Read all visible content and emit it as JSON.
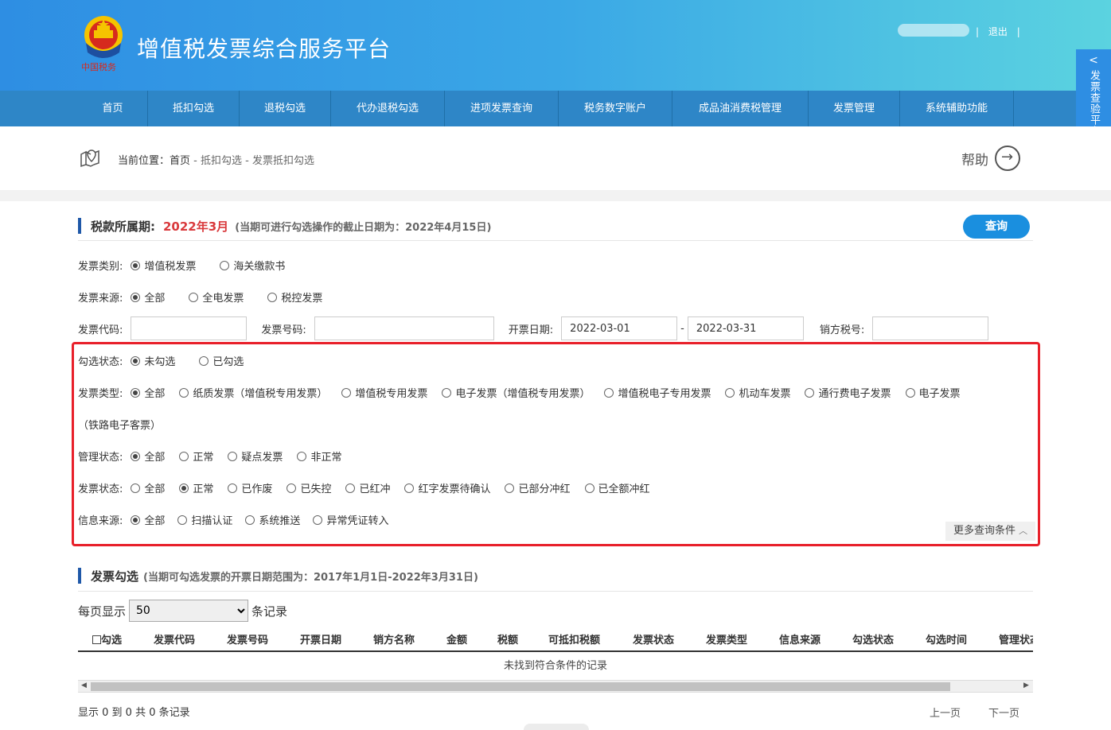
{
  "header": {
    "title": "增值税发票综合服务平台",
    "emblem_text": "中国税务",
    "user_sep_left": "|",
    "logout": "退出",
    "user_sep_right": "|"
  },
  "side_tab": {
    "label": "发票查验平台"
  },
  "nav": {
    "items": [
      "首页",
      "抵扣勾选",
      "退税勾选",
      "代办退税勾选",
      "进项发票查询",
      "税务数字账户",
      "成品油消费税管理",
      "发票管理",
      "系统辅助功能"
    ]
  },
  "breadcrumb": {
    "prefix": "当前位置：",
    "items": [
      "首页",
      "抵扣勾选",
      "发票抵扣勾选"
    ],
    "sep": " - "
  },
  "help": "帮助",
  "tax_period": {
    "label": "税款所属期:",
    "value": "2022年3月",
    "note": "(当期可进行勾选操作的截止日期为：2022年4月15日)"
  },
  "query_button": "查询",
  "filters": {
    "invoice_category": {
      "label": "发票类别:",
      "options": [
        "增值税发票",
        "海关缴款书"
      ],
      "selected": 0
    },
    "invoice_source": {
      "label": "发票来源:",
      "options": [
        "全部",
        "全电发票",
        "税控发票"
      ],
      "selected": 0
    },
    "invoice_code": {
      "label": "发票代码:",
      "value": ""
    },
    "invoice_number": {
      "label": "发票号码:",
      "value": ""
    },
    "issue_date": {
      "label": "开票日期:",
      "start": "2022-03-01",
      "dash": "-",
      "end": "2022-03-31"
    },
    "seller_tax_id": {
      "label": "销方税号:",
      "value": ""
    },
    "check_status": {
      "label": "勾选状态:",
      "options": [
        "未勾选",
        "已勾选"
      ],
      "selected": 0
    },
    "invoice_type": {
      "label": "发票类型:",
      "options": [
        "全部",
        "纸质发票（增值税专用发票）",
        "增值税专用发票",
        "电子发票（增值税专用发票）",
        "增值税电子专用发票",
        "机动车发票",
        "通行费电子发票",
        "电子发票"
      ],
      "wrap_text": "（铁路电子客票）",
      "selected": 0
    },
    "management_status": {
      "label": "管理状态:",
      "options": [
        "全部",
        "正常",
        "疑点发票",
        "非正常"
      ],
      "selected": 0
    },
    "invoice_status": {
      "label": "发票状态:",
      "options": [
        "全部",
        "正常",
        "已作废",
        "已失控",
        "已红冲",
        "红字发票待确认",
        "已部分冲红",
        "已全额冲红"
      ],
      "selected": 1
    },
    "info_source": {
      "label": "信息来源:",
      "options": [
        "全部",
        "扫描认证",
        "系统推送",
        "异常凭证转入"
      ],
      "selected": 0
    },
    "more": "更多查询条件"
  },
  "invoice_section": {
    "title": "发票勾选",
    "note": "(当期可勾选发票的开票日期范围为：2017年1月1日-2022年3月31日)",
    "per_page_label": "每页显示",
    "per_page_value": "50",
    "records_label": "条记录",
    "columns": [
      "勾选",
      "发票代码",
      "发票号码",
      "开票日期",
      "销方名称",
      "金额",
      "税额",
      "可抵扣税额",
      "发票状态",
      "发票类型",
      "信息来源",
      "勾选状态",
      "勾选时间",
      "管理状态"
    ],
    "empty_text": "未找到符合条件的记录",
    "footer": "显示 0 到 0 共 0 条记录",
    "prev": "上一页",
    "next": "下一页"
  },
  "colors": {
    "accent": "#1a8fdf",
    "nav": "#2e86c7",
    "highlight": "#e8202a",
    "period": "#d9393c"
  }
}
